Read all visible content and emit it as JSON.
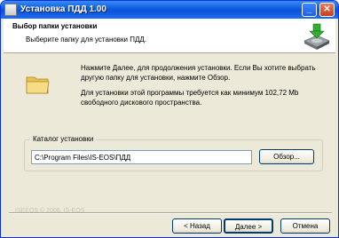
{
  "window": {
    "title": "Установка ПДД 1.00",
    "minimize_glyph": "_",
    "close_glyph": "✕"
  },
  "header": {
    "title": "Выбор папки установки",
    "subtitle": "Выберите папку для установки ПДД.",
    "icon": "hard-drive-install-icon"
  },
  "body": {
    "folder_icon": "folder-icon",
    "paragraph1": "Нажмите Далее, для продолжения установки. Если Вы хотите выбрать другую папку для установки, нажмите Обзор.",
    "paragraph2": "Для установки этой программы требуется как минимум 102,72 Mb свободного дискового пространства."
  },
  "install_dir": {
    "label": "Каталог установки",
    "value": "C:\\Program Files\\IS-EOS\\ПДД",
    "browse_label": "Обзор..."
  },
  "footer": {
    "watermark": "ISEEOS © 2006, IS-EOS",
    "back_label": "< Назад",
    "next_label": "Далее >",
    "cancel_label": "Отмена"
  },
  "colors": {
    "titlebar": "#0a5ce0",
    "dialog_bg": "#ece9d8",
    "folder": "#f0d36a",
    "install_arrow": "#2fae2f"
  }
}
